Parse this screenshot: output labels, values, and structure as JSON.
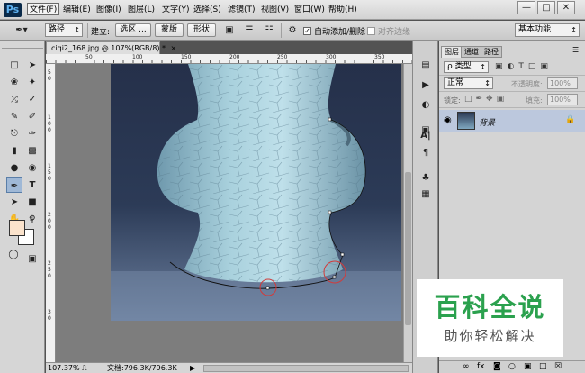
{
  "app": {
    "logo": "Ps",
    "workspace": "基本功能"
  },
  "menu": [
    "文件(F)",
    "编辑(E)",
    "图像(I)",
    "图层(L)",
    "文字(Y)",
    "选择(S)",
    "滤镜(T)",
    "视图(V)",
    "窗口(W)",
    "帮助(H)"
  ],
  "window_controls": {
    "minimize": "—",
    "restore": "□",
    "close": "✕"
  },
  "options": {
    "mode_value": "路径",
    "build_label": "建立:",
    "selection_btn": "选区 ...",
    "mask_btn": "蒙版",
    "shape_btn": "形状",
    "auto_add_delete": "自动添加/删除",
    "auto_add_check": "✓",
    "align_edges": "对齐边缘"
  },
  "document": {
    "tab_title": "ciqi2_168.jpg @ 107%(RGB/8) *",
    "tab_close": "×",
    "ruler_top": [
      "50",
      "100",
      "150",
      "200",
      "250",
      "300",
      "350"
    ],
    "ruler_left": [
      "5",
      "0",
      "1",
      "0",
      "0",
      "1",
      "5",
      "0",
      "2",
      "0",
      "0",
      "2",
      "5",
      "0",
      "3",
      "0"
    ],
    "zoom": "107.37%",
    "doc_info": "文档:796.3K/796.3K"
  },
  "layers_panel": {
    "tabs": [
      "图层",
      "通道",
      "路径"
    ],
    "kind_filter": "ρ 类型",
    "blend_mode": "正常",
    "opacity_label": "不透明度:",
    "opacity_value": "100%",
    "lock_label": "锁定:",
    "fill_label": "填充:",
    "fill_value": "100%",
    "layer_name": "背景",
    "bottom_icons": [
      "∞",
      "fx",
      "◙",
      "○",
      "▣",
      "□",
      "☒"
    ]
  },
  "watermark": {
    "title": "百科全说",
    "subtitle": "助你轻松解决"
  }
}
